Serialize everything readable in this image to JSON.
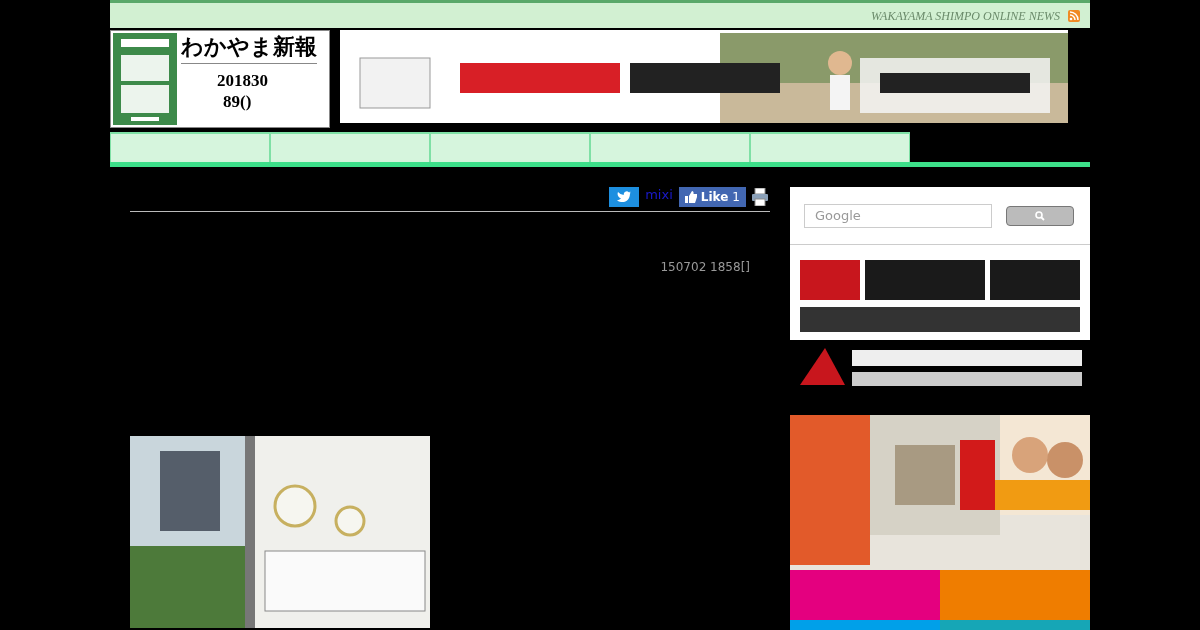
{
  "top_bar": {
    "site_tagline": "WAKAYAMA SHIMPO ONLINE NEWS"
  },
  "header": {
    "title": "わかやま新報",
    "date_line_1": "201830",
    "date_line_2": "89()"
  },
  "nav": {
    "tabs": [
      {
        "selected": false
      },
      {
        "selected": false
      },
      {
        "selected": false
      },
      {
        "selected": false
      },
      {
        "selected": false
      }
    ]
  },
  "share": {
    "mixi": "mixi",
    "like": "Like",
    "like_count": "1"
  },
  "article": {
    "posted": "150702 1858[]"
  },
  "sidebar": {
    "search": {
      "placeholder": "Google"
    }
  }
}
